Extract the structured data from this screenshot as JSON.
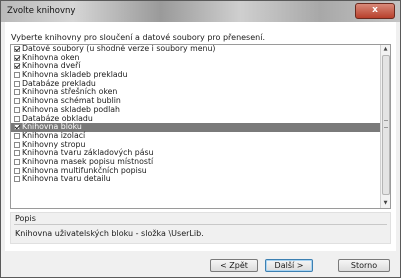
{
  "window": {
    "title": "Zvolte knihovny",
    "close_glyph": "x"
  },
  "instruction": "Vyberte knihovny pro sloučení a datové soubory pro přenesení.",
  "libraries": [
    {
      "label": "Datové soubory (u shodné verze i soubory menu)",
      "checked": true,
      "selected": false
    },
    {
      "label": "Knihovna oken",
      "checked": true,
      "selected": false
    },
    {
      "label": "Knihovna dveří",
      "checked": true,
      "selected": false
    },
    {
      "label": "Knihovna skladeb prekladu",
      "checked": false,
      "selected": false
    },
    {
      "label": "Databáze prekladu",
      "checked": false,
      "selected": false
    },
    {
      "label": "Knihovna střešních oken",
      "checked": false,
      "selected": false
    },
    {
      "label": "Knihovna schémat bublin",
      "checked": false,
      "selected": false
    },
    {
      "label": "Knihovna skladeb podlah",
      "checked": false,
      "selected": false
    },
    {
      "label": "Databáze obkladu",
      "checked": false,
      "selected": false
    },
    {
      "label": "Knihovna bloku",
      "checked": true,
      "selected": true
    },
    {
      "label": "Knihovna izolací",
      "checked": false,
      "selected": false
    },
    {
      "label": "Knihovny stropu",
      "checked": false,
      "selected": false
    },
    {
      "label": "Knihovna tvaru základových pásu",
      "checked": false,
      "selected": false
    },
    {
      "label": "Knihovna masek popisu místností",
      "checked": false,
      "selected": false
    },
    {
      "label": "Knihovna multifunkčních popisu",
      "checked": false,
      "selected": false
    },
    {
      "label": "Knihovna tvaru detailu",
      "checked": false,
      "selected": false
    }
  ],
  "scrollbar": {
    "up_glyph": "▲",
    "down_glyph": "▼"
  },
  "description": {
    "label": "Popis",
    "text": "Knihovna uživatelských bloku - složka \\UserLib."
  },
  "buttons": {
    "back": "< Zpět",
    "next": "Další >",
    "cancel": "Storno"
  }
}
